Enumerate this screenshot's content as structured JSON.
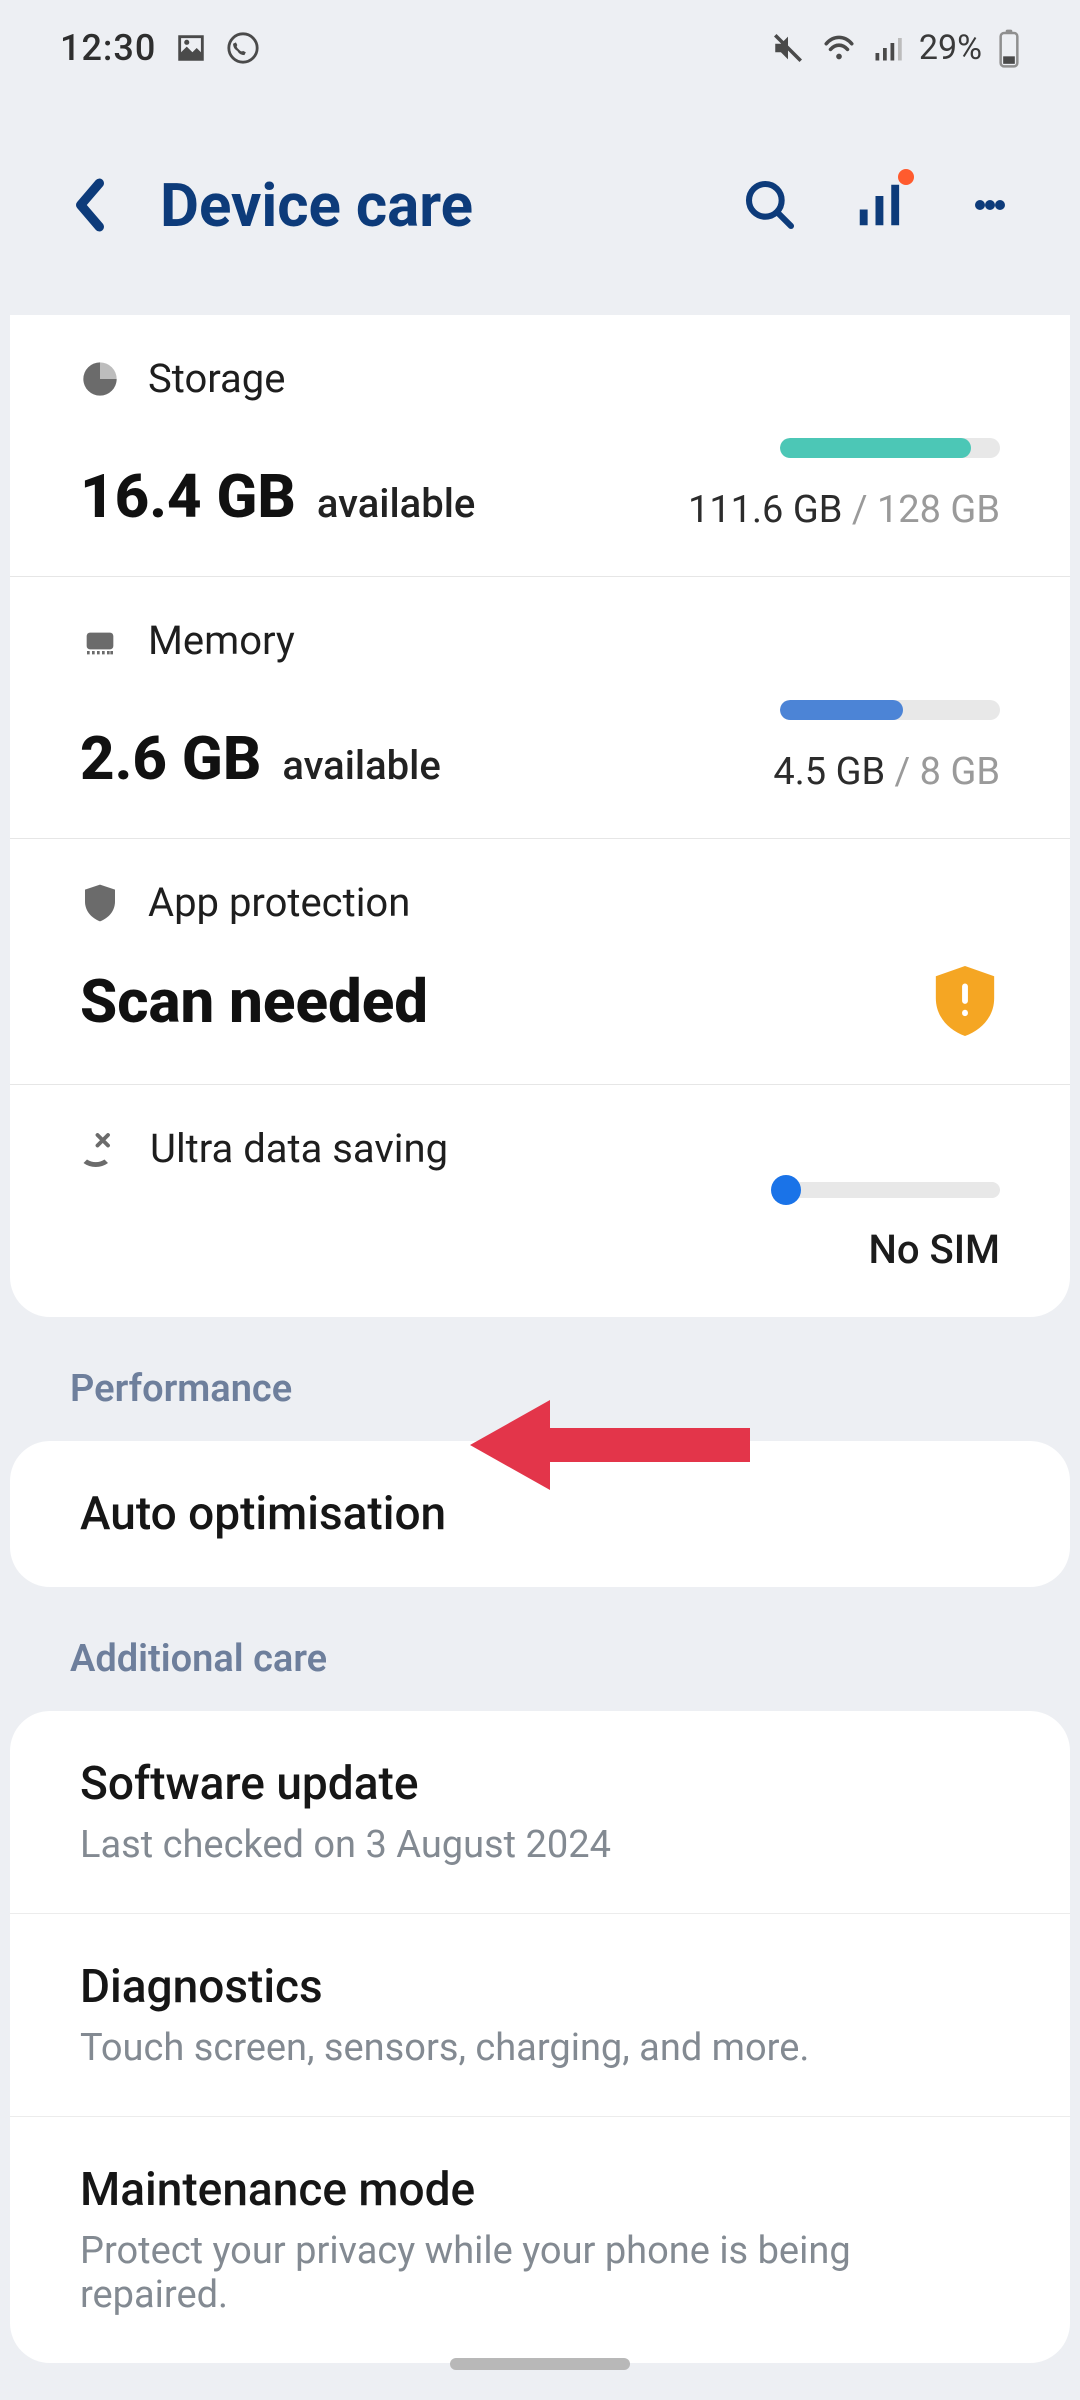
{
  "statusbar": {
    "time": "12:30",
    "battery_pct": "29%"
  },
  "appbar": {
    "title": "Device care"
  },
  "storage": {
    "label": "Storage",
    "value": "16.4 GB",
    "suffix": "available",
    "used": "111.6 GB",
    "total": "128 GB"
  },
  "memory": {
    "label": "Memory",
    "value": "2.6 GB",
    "suffix": "available",
    "used": "4.5 GB",
    "total": "8 GB"
  },
  "protection": {
    "label": "App protection",
    "status": "Scan needed"
  },
  "uds": {
    "label": "Ultra data saving",
    "status": "No SIM"
  },
  "sections": {
    "performance": "Performance",
    "additional": "Additional care"
  },
  "performance": {
    "auto_opt": "Auto optimisation"
  },
  "additional": {
    "software_update": {
      "title": "Software update",
      "sub": "Last checked on 3 August 2024"
    },
    "diagnostics": {
      "title": "Diagnostics",
      "sub": "Touch screen, sensors, charging, and more."
    },
    "maintenance": {
      "title": "Maintenance mode",
      "sub": "Protect your privacy while your phone is being repaired."
    }
  }
}
